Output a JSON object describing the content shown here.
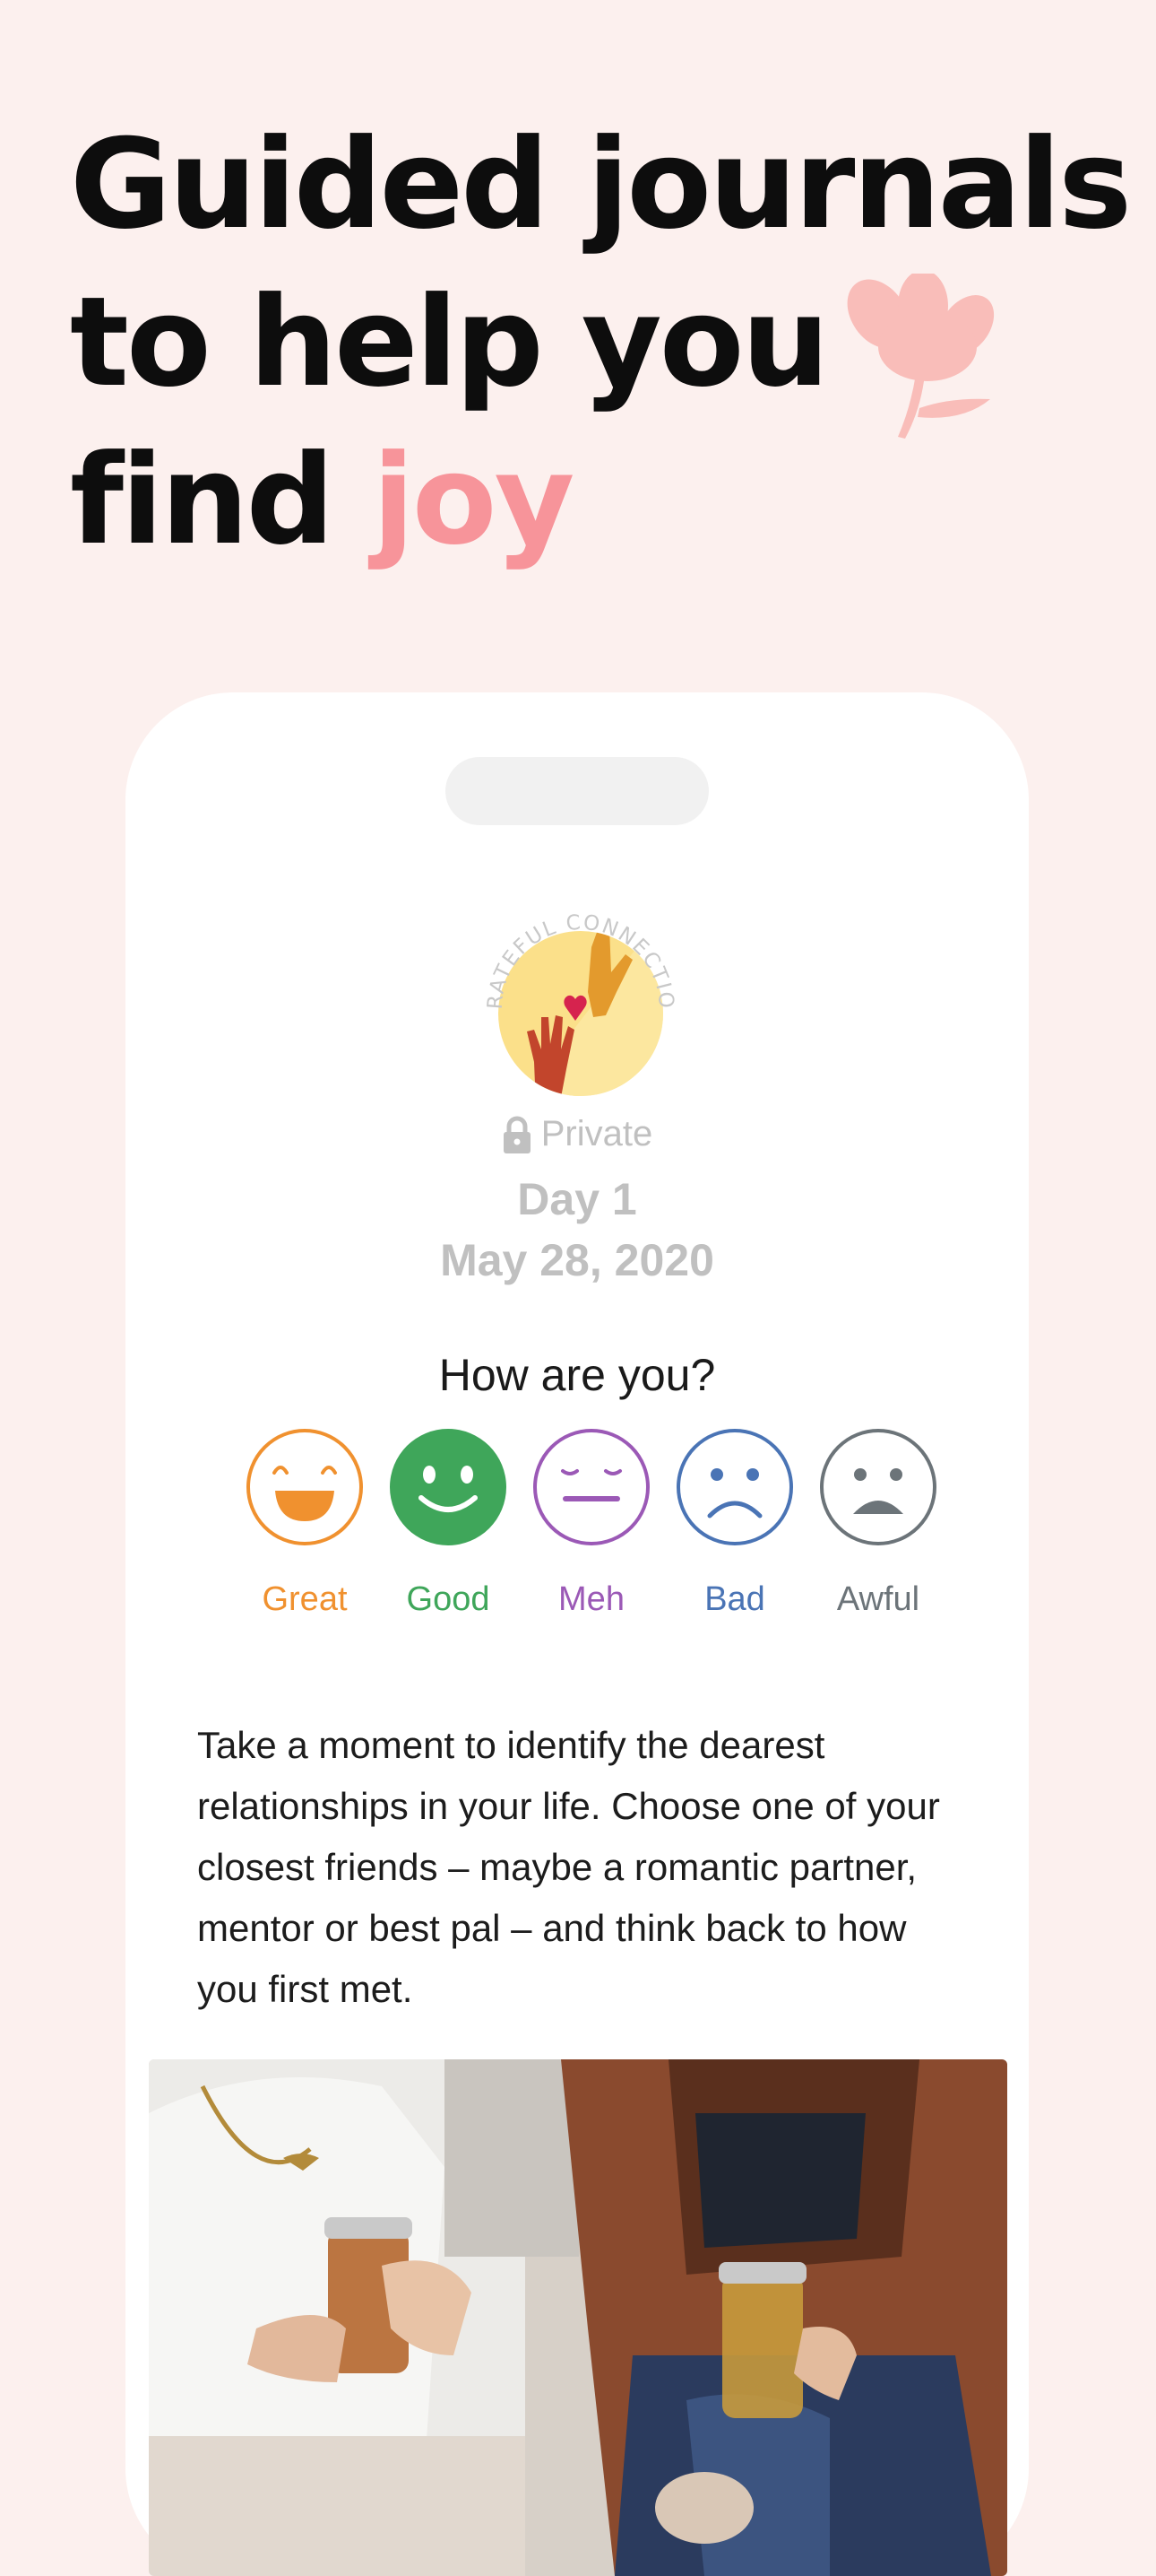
{
  "headline": {
    "line1": "Guided journals",
    "line2": "to help you",
    "line3_prefix": "find ",
    "line3_accent": "joy"
  },
  "colors": {
    "background": "#fcf0ee",
    "accent": "#f7949a",
    "great": "#f0912f",
    "good": "#3fa65a",
    "meh": "#9b59b6",
    "bad": "#4a74b5",
    "awful": "#6c7479"
  },
  "entry": {
    "badge_text": "GRATEFUL CONNECTION",
    "privacy_icon": "lock-icon",
    "privacy": "Private",
    "day": "Day 1",
    "date": "May 28, 2020"
  },
  "mood": {
    "question": "How are you?",
    "options": [
      {
        "label": "Great",
        "icon": "grinning-face-icon"
      },
      {
        "label": "Good",
        "icon": "smiling-face-icon"
      },
      {
        "label": "Meh",
        "icon": "neutral-face-icon"
      },
      {
        "label": "Bad",
        "icon": "frowning-face-icon"
      },
      {
        "label": "Awful",
        "icon": "sad-face-icon"
      }
    ]
  },
  "prompt": "Take a moment to identify the dearest relationships in your life. Choose one of your closest friends – maybe a romantic partner, mentor or best pal – and think back to how you first met."
}
